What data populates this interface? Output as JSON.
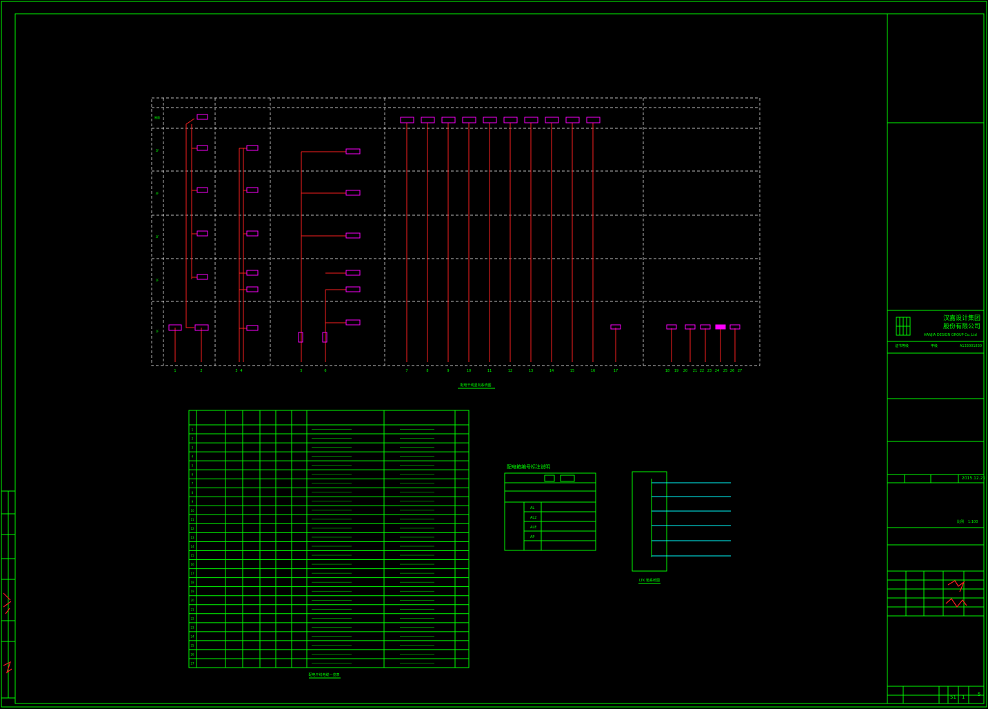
{
  "title_block": {
    "company_cn_line1": "汉嘉设计集团",
    "company_cn_line2": "股份有限公司",
    "company_en": "HANJIA DESIGN GROUP Co.,Ltd",
    "cert_label": "证书等级",
    "cert_value": "甲级",
    "cert_no": "A133001830",
    "date": "2015.12.21",
    "scale_label": "比例",
    "scale_value": "1:100",
    "sheet_no": "51",
    "page_a": "1",
    "page_b": "5"
  },
  "riser": {
    "floor_labels": [
      "屋面",
      "5F",
      "4F",
      "3F",
      "2F",
      "1F"
    ],
    "column_numbers": [
      "1",
      "2",
      "3",
      "4",
      "5",
      "6",
      "7",
      "8",
      "9",
      "10",
      "11",
      "12",
      "13",
      "14",
      "15",
      "16",
      "17",
      "18",
      "19",
      "20",
      "21",
      "22",
      "23",
      "24",
      "25",
      "26",
      "27"
    ],
    "caption": "配电干线竖向系统图"
  },
  "cable_table": {
    "caption": "配电干线电缆一览表",
    "rows": [
      "1",
      "2",
      "3",
      "4",
      "5",
      "6",
      "7",
      "8",
      "9",
      "10",
      "11",
      "12",
      "13",
      "14",
      "15",
      "16",
      "17",
      "18",
      "19",
      "20",
      "21",
      "22",
      "23",
      "24",
      "25",
      "26",
      "27"
    ]
  },
  "legend": {
    "title": "配电箱编号标注说明",
    "codes": [
      "AL",
      "AL2",
      "ALE",
      "AP"
    ]
  },
  "ltk": {
    "caption": "LTK 箱系统图"
  },
  "colors": {
    "frame": "#00ff00",
    "wire": "#ff2020",
    "box": "#ff00ff",
    "dash": "#ffffff",
    "cyan": "#00ffff"
  }
}
